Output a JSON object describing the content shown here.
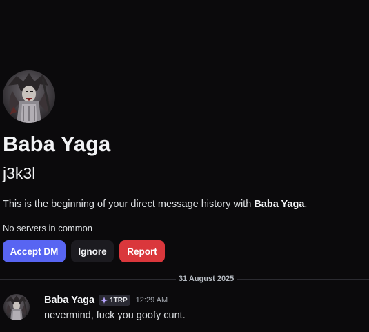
{
  "colors": {
    "background": "#0b0a0c",
    "accept_button": "#5865f2",
    "ignore_button": "#1c1b20",
    "report_button": "#da373c",
    "tag_background": "#2a2a33",
    "tag_icon": "#b8a6ff"
  },
  "profile": {
    "display_name": "Baba Yaga",
    "username": "j3k3l",
    "avatar_icon": "user-avatar"
  },
  "intro": {
    "text_prefix": "This is the beginning of your direct message history with ",
    "text_name": "Baba Yaga",
    "text_suffix": "."
  },
  "mutual_servers": "No servers in common",
  "actions": {
    "accept_label": "Accept DM",
    "ignore_label": "Ignore",
    "report_label": "Report"
  },
  "divider": {
    "date": "31 August 2025"
  },
  "message": {
    "author": "Baba Yaga",
    "tag_icon": "sparkle-icon",
    "tag": "1TRP",
    "time": "12:29 AM",
    "content": "nevermind, fuck you goofy cunt."
  }
}
